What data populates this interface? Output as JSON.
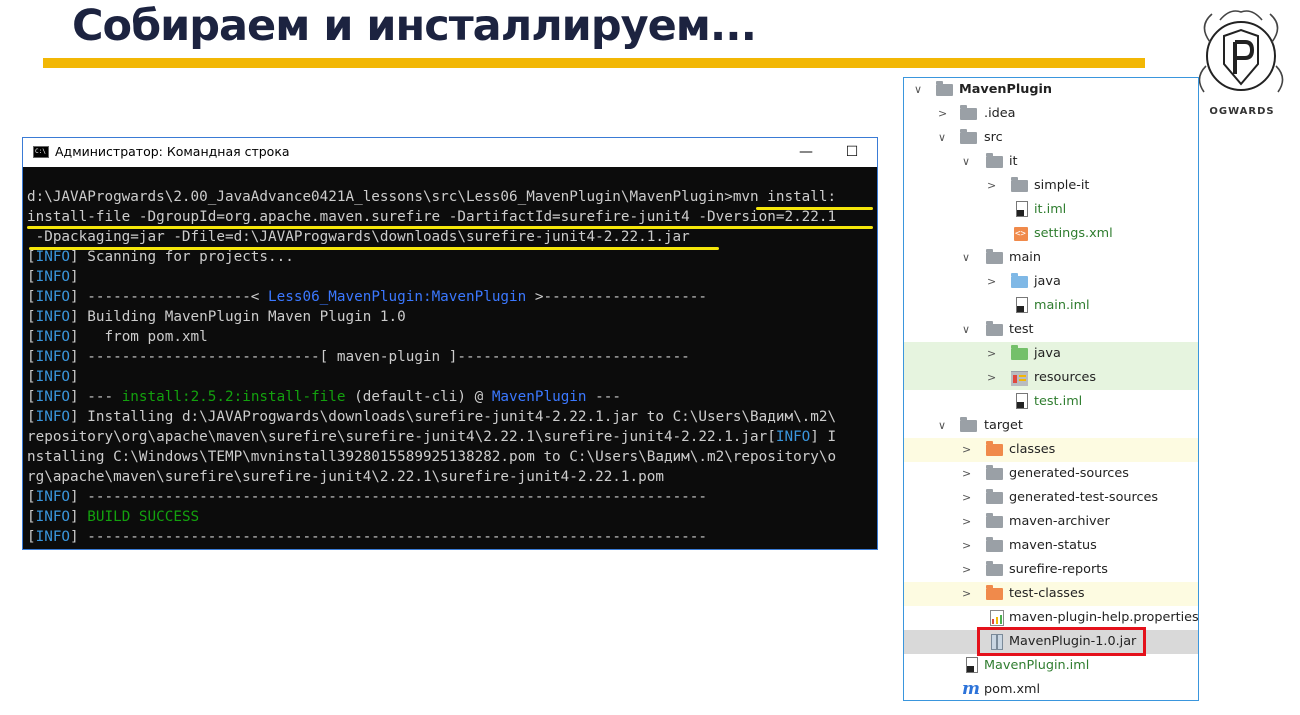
{
  "slide": {
    "title": "Собираем и инсталлируем...",
    "logo_text": "PROGWARDS"
  },
  "colors": {
    "accent_bar": "#f2b705",
    "console_bg": "#0c0c0c",
    "info": "#3a96dd",
    "success": "#13a10e",
    "highlight_underline": "#f5e60a",
    "selection_box": "#e4111b"
  },
  "console": {
    "window_title": "Администратор: Командная строка",
    "buttons": {
      "minimize": "—",
      "maximize": "☐",
      "close": "✕"
    },
    "cmd_prompt": "d:\\JAVAProgwards\\2.00_JavaAdvance0421A_lessons\\src\\Less06_MavenPlugin\\MavenPlugin>",
    "cmd_start": "mvn install:",
    "cmd_line2": "install-file -DgroupId=org.apache.maven.surefire -DartifactId=surefire-junit4 -Dversion=2.22.1",
    "cmd_line3": " -Dpackaging=jar -Dfile=d:\\JAVAProgwards\\downloads\\surefire-junit4-2.22.1.jar",
    "tag": "INFO",
    "scanning": " Scanning for projects...",
    "sep1_pre": " -------------------< ",
    "project_id": "Less06_MavenPlugin:MavenPlugin",
    "sep1_post": " >-------------------",
    "building": " Building MavenPlugin Maven Plugin 1.0",
    "from_pom": "   from pom.xml",
    "sep2": " ---------------------------[ maven-plugin ]---------------------------",
    "plugin_pre": " --- ",
    "plugin_goal": "install:2.5.2:install-file",
    "plugin_mid": " (default-cli) @ ",
    "plugin_project": "MavenPlugin",
    "plugin_post": " ---",
    "install_line1": " Installing d:\\JAVAProgwards\\downloads\\surefire-junit4-2.22.1.jar to C:\\Users\\Вадим\\.m2\\",
    "install_line2_a": "repository\\org\\apache\\maven\\surefire\\surefire-junit4\\2.22.1\\surefire-junit4-2.22.1.jar",
    "install_line2_b": " I",
    "install_line3": "nstalling C:\\Windows\\TEMP\\mvninstall3928015589925138282.pom to C:\\Users\\Вадим\\.m2\\repository\\o",
    "install_line4": "rg\\apache\\maven\\surefire\\surefire-junit4\\2.22.1\\surefire-junit4-2.22.1.pom",
    "sep3": " ------------------------------------------------------------------------",
    "build_success": " BUILD SUCCESS"
  },
  "tree": {
    "items": [
      {
        "label": "MavenPlugin"
      },
      {
        "label": ".idea"
      },
      {
        "label": "src"
      },
      {
        "label": "it"
      },
      {
        "label": "simple-it"
      },
      {
        "label": "it.iml"
      },
      {
        "label": "settings.xml"
      },
      {
        "label": "main"
      },
      {
        "label": "java"
      },
      {
        "label": "main.iml"
      },
      {
        "label": "test"
      },
      {
        "label": "java"
      },
      {
        "label": "resources"
      },
      {
        "label": "test.iml"
      },
      {
        "label": "target"
      },
      {
        "label": "classes"
      },
      {
        "label": "generated-sources"
      },
      {
        "label": "generated-test-sources"
      },
      {
        "label": "maven-archiver"
      },
      {
        "label": "maven-status"
      },
      {
        "label": "surefire-reports"
      },
      {
        "label": "test-classes"
      },
      {
        "label": "maven-plugin-help.properties"
      },
      {
        "label": "MavenPlugin-1.0.jar"
      },
      {
        "label": "MavenPlugin.iml"
      },
      {
        "label": "pom.xml"
      }
    ],
    "selected_item": "MavenPlugin-1.0.jar"
  }
}
